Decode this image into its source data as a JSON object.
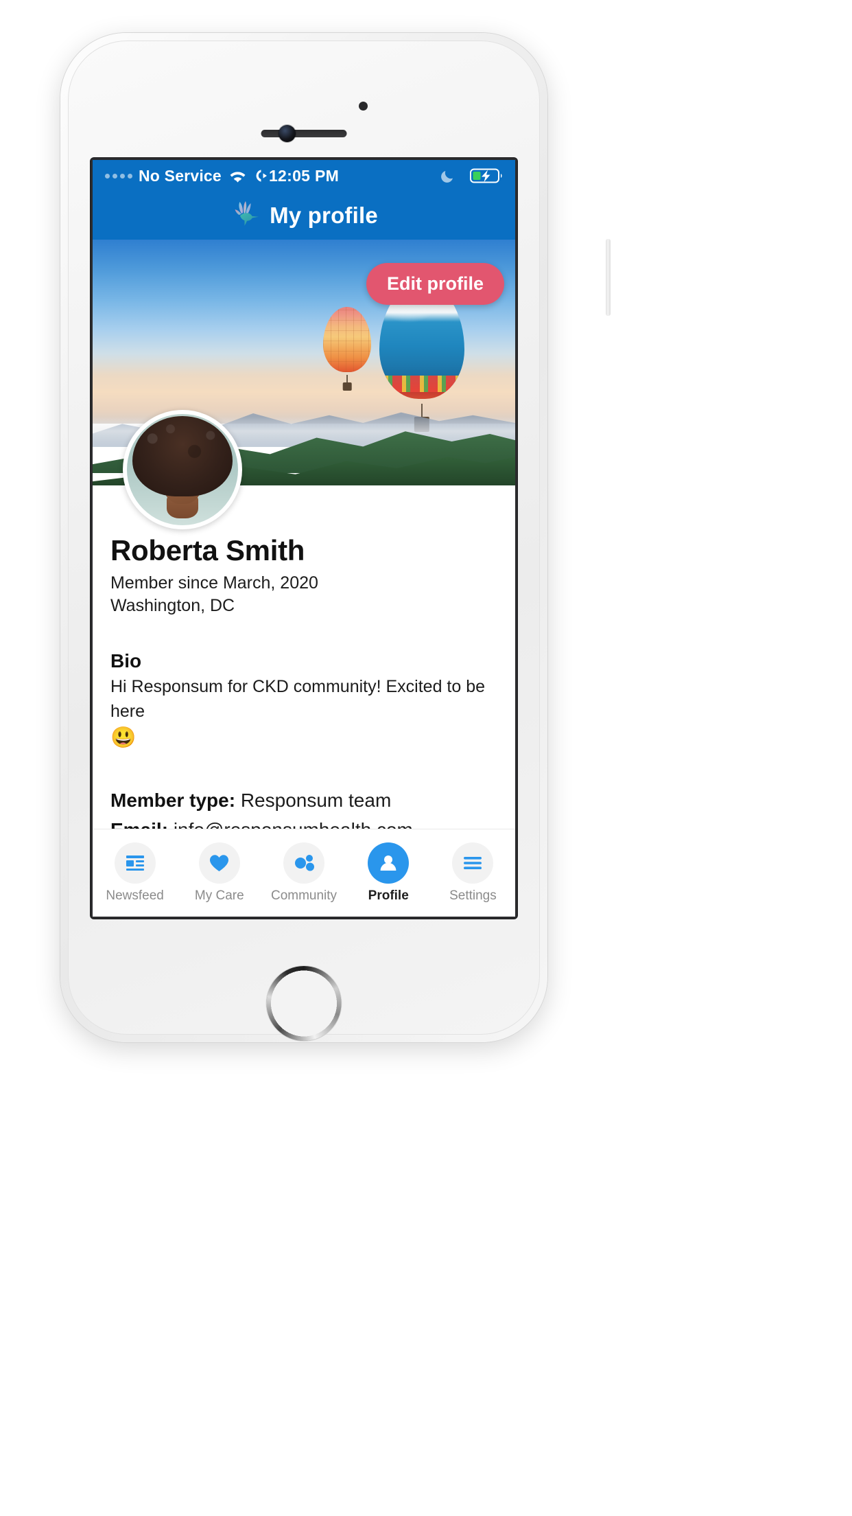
{
  "status_bar": {
    "carrier": "No Service",
    "time": "12:05 PM",
    "icons": [
      "signal-dots-icon",
      "wifi-icon",
      "call-forwarding-icon",
      "do-not-disturb-moon-icon",
      "battery-charging-icon"
    ]
  },
  "header": {
    "title": "My profile",
    "logo": "hummingbird-logo-icon"
  },
  "cover": {
    "edit_button_label": "Edit profile",
    "edit_button_color": "#e2566f",
    "description": "hot-air-balloons-over-mountains-at-sunrise"
  },
  "profile": {
    "avatar": "user-avatar-photo",
    "name": "Roberta Smith",
    "member_since": "Member since March, 2020",
    "location": "Washington, DC"
  },
  "bio": {
    "heading": "Bio",
    "text": "Hi Responsum for CKD community! Excited to be here",
    "emoji": "😃"
  },
  "details": [
    {
      "label": "Member type:",
      "value": "Responsum team"
    },
    {
      "label": "Email:",
      "value": "info@responsumhealth.com"
    }
  ],
  "tabs": [
    {
      "label": "Newsfeed",
      "icon": "newsfeed-icon",
      "active": false
    },
    {
      "label": "My Care",
      "icon": "heart-icon",
      "active": false
    },
    {
      "label": "Community",
      "icon": "community-dots-icon",
      "active": false
    },
    {
      "label": "Profile",
      "icon": "person-icon",
      "active": true
    },
    {
      "label": "Settings",
      "icon": "hamburger-menu-icon",
      "active": false
    }
  ],
  "colors": {
    "header_blue": "#0a6fc2",
    "accent_blue": "#2a96ec",
    "accent_pink": "#e2566f"
  }
}
